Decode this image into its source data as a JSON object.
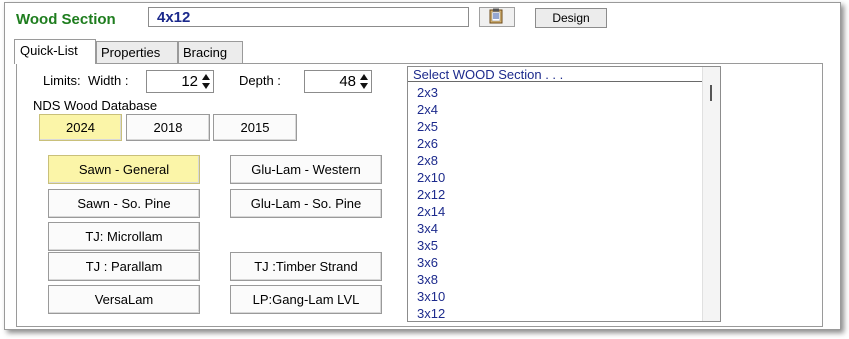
{
  "header": {
    "title": "Wood Section",
    "section_value": "4x12",
    "design_label": "Design"
  },
  "tabs": [
    {
      "label": "Quick-List",
      "active": true
    },
    {
      "label": "Properties",
      "active": false
    },
    {
      "label": "Bracing",
      "active": false
    }
  ],
  "limits": {
    "label": "Limits:",
    "width_label": "Width :",
    "width_value": "12",
    "depth_label": "Depth :",
    "depth_value": "48"
  },
  "database": {
    "label": "NDS Wood Database",
    "years": [
      {
        "label": "2024",
        "selected": true
      },
      {
        "label": "2018",
        "selected": false
      },
      {
        "label": "2015",
        "selected": false
      }
    ]
  },
  "materials": {
    "sawn_general": "Sawn - General",
    "glulam_western": "Glu-Lam - Western",
    "sawn_so_pine": "Sawn - So. Pine",
    "glulam_so_pine": "Glu-Lam - So. Pine",
    "tj_microllam": "TJ: Microllam",
    "tj_parallam": "TJ : Parallam",
    "tj_timber_strand": "TJ :Timber Strand",
    "versalam": "VersaLam",
    "lp_ganglam": "LP:Gang-Lam LVL",
    "selected": "Sawn - General"
  },
  "section_list": {
    "header": "Select WOOD Section . . .",
    "items": [
      "2x3",
      "2x4",
      "2x5",
      "2x6",
      "2x8",
      "2x10",
      "2x12",
      "2x14",
      "3x4",
      "3x5",
      "3x6",
      "3x8",
      "3x10",
      "3x12"
    ]
  },
  "colors": {
    "title_green": "#1e7d1e",
    "list_text": "#1c2a8c",
    "selected_yellow": "#fbf5a8"
  }
}
